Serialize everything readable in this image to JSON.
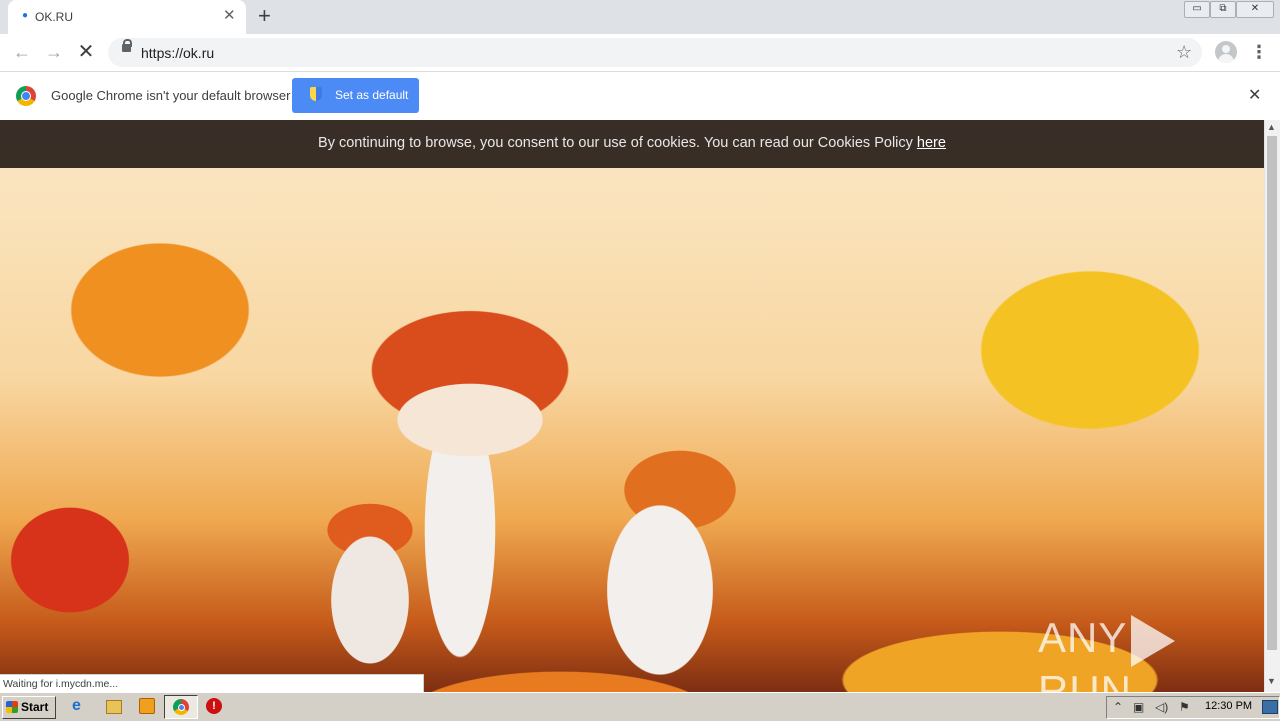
{
  "browser": {
    "tab": {
      "title": "OK.RU",
      "close_glyph": "✕"
    },
    "new_tab_glyph": "+",
    "window_controls": {
      "minimize": "▭",
      "maximize": "⧉",
      "close": "✕"
    },
    "toolbar": {
      "back_glyph": "←",
      "forward_glyph": "→",
      "stop_glyph": "✕",
      "url": "https://ok.ru",
      "bookmark_glyph": "☆",
      "menu_glyph": "⋮"
    },
    "infobar": {
      "message": "Google Chrome isn't your default browser",
      "button_label": "Set as default",
      "close_glyph": "✕"
    },
    "status_text": "Waiting for i.mycdn.me..."
  },
  "page": {
    "cookie_text": "By continuing to browse, you consent to our use of cookies. You can read our Cookies Policy ",
    "cookie_link": "here",
    "watermark_left": "ANY",
    "watermark_right": "RUN"
  },
  "scrollbar": {
    "up_glyph": "▲",
    "down_glyph": "▼"
  },
  "taskbar": {
    "start_label": "Start",
    "ie_glyph": "e",
    "stop_glyph": "!",
    "tray": {
      "chevron_glyph": "⌃",
      "network_glyph": "▣",
      "volume_glyph": "◁)",
      "flag_glyph": "⚑"
    },
    "clock": "12:30 PM"
  },
  "icons": [
    "chrome-icon",
    "shield-icon",
    "lock-icon",
    "star-icon",
    "profile-icon",
    "menu-icon",
    "windows-flag-icon",
    "ie-icon",
    "explorer-icon",
    "media-player-icon",
    "chrome-taskbar-icon",
    "stop-icon"
  ]
}
